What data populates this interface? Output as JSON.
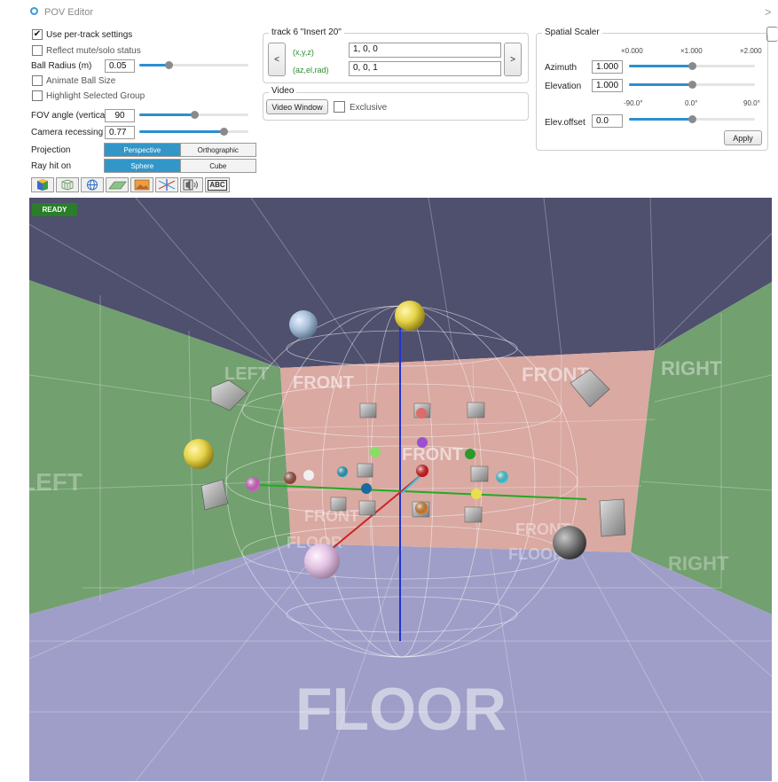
{
  "app": {
    "title": "POV Editor",
    "chevron": ">"
  },
  "options": {
    "use_per_track": {
      "label": "Use per-track settings",
      "checked": true,
      "mark": "✔"
    },
    "reflect_mute": {
      "label": "Reflect mute/solo status",
      "checked": false
    },
    "ball_radius": {
      "label": "Ball Radius (m)",
      "value": "0.05",
      "level": 0.27
    },
    "animate_ball": {
      "label": "Animate Ball Size",
      "checked": false
    },
    "highlight_group": {
      "label": "Highlight Selected Group",
      "checked": false
    },
    "fov": {
      "label": "FOV angle (vertical)",
      "value": "90",
      "level": 0.5
    },
    "camera": {
      "label": "Camera recessing",
      "value": "0.77",
      "level": 0.77
    },
    "projection": {
      "label": "Projection",
      "options": [
        "Perspective",
        "Orthographic"
      ],
      "selected": "Perspective"
    },
    "ray_hit": {
      "label": "Ray hit on",
      "options": [
        "Sphere",
        "Cube"
      ],
      "selected": "Sphere"
    }
  },
  "toolbar_icons": [
    "color-cube-icon",
    "cube-wire-icon",
    "globe-icon",
    "floor-plane-icon",
    "image-icon",
    "axes-icon",
    "speaker-icon",
    "text-abc-icon"
  ],
  "toolbar_abc_label": "ABC",
  "track": {
    "title": "track 6 \"Insert 20\"",
    "prev": "<",
    "next": ">",
    "xyz_label": "(x,y,z)",
    "xyz_value": "1, 0, 0",
    "aer_label": "(az,el,rad)",
    "aer_value": "0, 0, 1"
  },
  "video": {
    "title": "Video",
    "button": "Video Window",
    "exclusive_label": "Exclusive",
    "exclusive_checked": false
  },
  "scaler": {
    "title": "Spatial Scaler",
    "scale_ticks": [
      "×0.000",
      "×1.000",
      "×2.000"
    ],
    "azimuth": {
      "label": "Azimuth",
      "value": "1.000",
      "level": 0.5
    },
    "elevation": {
      "label": "Elevation",
      "value": "1.000",
      "level": 0.5
    },
    "angle_ticks": [
      "-90.0°",
      "0.0°",
      "90.0°"
    ],
    "elev_offset": {
      "label": "Elev.offset",
      "value": "0.0",
      "level": 0.5
    },
    "apply": "Apply"
  },
  "viewport": {
    "status": "READY",
    "wall_text": {
      "front": "FRONT",
      "left": "LEFT",
      "right": "RIGHT",
      "floor": "FLOOR"
    },
    "colors": {
      "ceiling": "#4f4f6e",
      "back_wall": "#d9a9a2",
      "side_wall": "#72a06f",
      "floor": "#9e9ec8",
      "accent": "#3396c8",
      "ready": "#2a7d2a"
    }
  }
}
